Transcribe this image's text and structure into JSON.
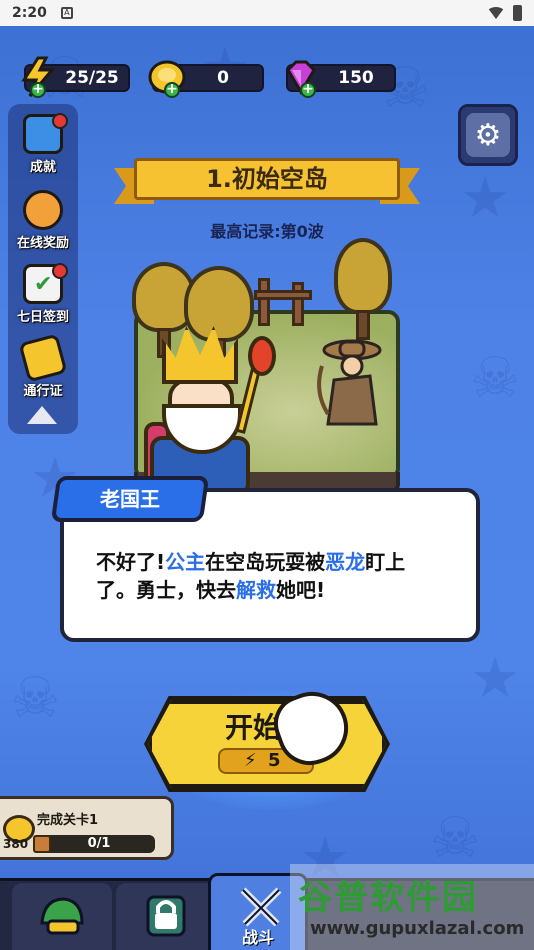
{
  "status_bar": {
    "time": "2:20"
  },
  "resources": {
    "energy": "25/25",
    "coins": "0",
    "gems": "150"
  },
  "sidebar": {
    "items": [
      {
        "label": "成就",
        "icon": "achievement-icon",
        "has_dot": true
      },
      {
        "label": "在线奖励",
        "icon": "stopwatch-icon",
        "has_dot": false
      },
      {
        "label": "七日签到",
        "icon": "calendar-check-icon",
        "has_dot": true
      },
      {
        "label": "通行证",
        "icon": "pass-ticket-icon",
        "has_dot": false
      }
    ]
  },
  "stage": {
    "title": "1.初始空岛",
    "record": "最高记录:第0波"
  },
  "dialog": {
    "speaker": "老国王",
    "line1_a": "不好了!",
    "line1_hl1": "公主",
    "line1_b": "在空岛玩耍被",
    "line1_hl2": "恶龙",
    "line1_c": "盯上",
    "line2_a": "了。勇士，快去",
    "line2_hl": "解救",
    "line2_b": "她吧!"
  },
  "start_button": {
    "label": "开始游",
    "cost": "5"
  },
  "mission": {
    "title": "完成关卡1",
    "reward": "380",
    "progress": "0/1",
    "progress_fraction": 0
  },
  "bottom_nav": {
    "tabs": [
      {
        "label": "",
        "icon": "hero-helmet-icon"
      },
      {
        "label": "",
        "icon": "lock-icon"
      },
      {
        "label": "战斗",
        "icon": "crossed-swords-icon",
        "active": true
      }
    ]
  },
  "watermark": {
    "title": "谷普软件园",
    "url": "www.gupuxlazal.com"
  },
  "colors": {
    "background": "#4f84e8",
    "banner": "#f6c232",
    "dialog_highlight": "#2a6ee8",
    "start_button": "#f7d33a",
    "active_tab": "#4f7fe0"
  }
}
